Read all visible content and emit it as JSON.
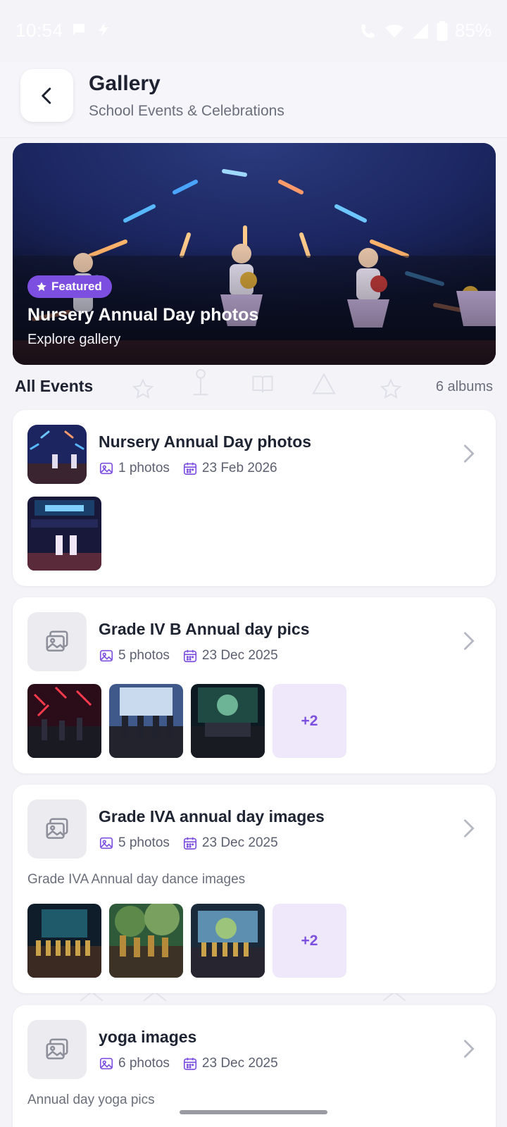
{
  "status_bar": {
    "time": "10:54",
    "battery": "85%"
  },
  "header": {
    "title": "Gallery",
    "subtitle": "School Events & Celebrations"
  },
  "featured": {
    "badge": "Featured",
    "title": "Nursery Annual Day photos",
    "link": "Explore gallery"
  },
  "section": {
    "title": "All Events",
    "count": "6 albums"
  },
  "albums": [
    {
      "title": "Nursery Annual Day photos",
      "photos": "1 photos",
      "date": "23 Feb 2026",
      "description": "",
      "more": ""
    },
    {
      "title": "Grade IV B Annual day pics",
      "photos": "5 photos",
      "date": "23 Dec 2025",
      "description": "",
      "more": "+2"
    },
    {
      "title": "Grade IVA annual day images",
      "photos": "5 photos",
      "date": "23 Dec 2025",
      "description": "Grade IVA Annual day dance images",
      "more": "+2"
    },
    {
      "title": "yoga images",
      "photos": "6 photos",
      "date": "23 Dec 2025",
      "description": "Annual day yoga pics",
      "more": ""
    }
  ],
  "colors": {
    "accent": "#7c4fe0",
    "background": "#f3f3f8",
    "card": "#ffffff"
  }
}
